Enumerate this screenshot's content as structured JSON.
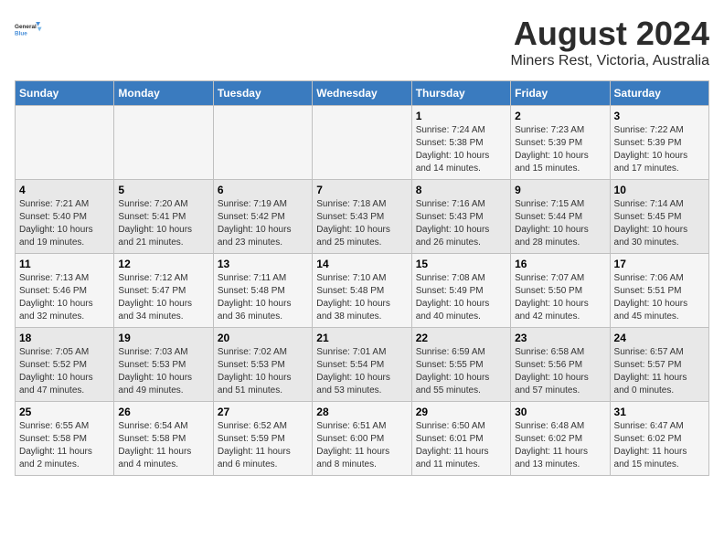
{
  "header": {
    "logo_line1": "General",
    "logo_line2": "Blue",
    "main_title": "August 2024",
    "subtitle": "Miners Rest, Victoria, Australia"
  },
  "days_of_week": [
    "Sunday",
    "Monday",
    "Tuesday",
    "Wednesday",
    "Thursday",
    "Friday",
    "Saturday"
  ],
  "weeks": [
    [
      {
        "day": "",
        "info": ""
      },
      {
        "day": "",
        "info": ""
      },
      {
        "day": "",
        "info": ""
      },
      {
        "day": "",
        "info": ""
      },
      {
        "day": "1",
        "info": "Sunrise: 7:24 AM\nSunset: 5:38 PM\nDaylight: 10 hours\nand 14 minutes."
      },
      {
        "day": "2",
        "info": "Sunrise: 7:23 AM\nSunset: 5:39 PM\nDaylight: 10 hours\nand 15 minutes."
      },
      {
        "day": "3",
        "info": "Sunrise: 7:22 AM\nSunset: 5:39 PM\nDaylight: 10 hours\nand 17 minutes."
      }
    ],
    [
      {
        "day": "4",
        "info": "Sunrise: 7:21 AM\nSunset: 5:40 PM\nDaylight: 10 hours\nand 19 minutes."
      },
      {
        "day": "5",
        "info": "Sunrise: 7:20 AM\nSunset: 5:41 PM\nDaylight: 10 hours\nand 21 minutes."
      },
      {
        "day": "6",
        "info": "Sunrise: 7:19 AM\nSunset: 5:42 PM\nDaylight: 10 hours\nand 23 minutes."
      },
      {
        "day": "7",
        "info": "Sunrise: 7:18 AM\nSunset: 5:43 PM\nDaylight: 10 hours\nand 25 minutes."
      },
      {
        "day": "8",
        "info": "Sunrise: 7:16 AM\nSunset: 5:43 PM\nDaylight: 10 hours\nand 26 minutes."
      },
      {
        "day": "9",
        "info": "Sunrise: 7:15 AM\nSunset: 5:44 PM\nDaylight: 10 hours\nand 28 minutes."
      },
      {
        "day": "10",
        "info": "Sunrise: 7:14 AM\nSunset: 5:45 PM\nDaylight: 10 hours\nand 30 minutes."
      }
    ],
    [
      {
        "day": "11",
        "info": "Sunrise: 7:13 AM\nSunset: 5:46 PM\nDaylight: 10 hours\nand 32 minutes."
      },
      {
        "day": "12",
        "info": "Sunrise: 7:12 AM\nSunset: 5:47 PM\nDaylight: 10 hours\nand 34 minutes."
      },
      {
        "day": "13",
        "info": "Sunrise: 7:11 AM\nSunset: 5:48 PM\nDaylight: 10 hours\nand 36 minutes."
      },
      {
        "day": "14",
        "info": "Sunrise: 7:10 AM\nSunset: 5:48 PM\nDaylight: 10 hours\nand 38 minutes."
      },
      {
        "day": "15",
        "info": "Sunrise: 7:08 AM\nSunset: 5:49 PM\nDaylight: 10 hours\nand 40 minutes."
      },
      {
        "day": "16",
        "info": "Sunrise: 7:07 AM\nSunset: 5:50 PM\nDaylight: 10 hours\nand 42 minutes."
      },
      {
        "day": "17",
        "info": "Sunrise: 7:06 AM\nSunset: 5:51 PM\nDaylight: 10 hours\nand 45 minutes."
      }
    ],
    [
      {
        "day": "18",
        "info": "Sunrise: 7:05 AM\nSunset: 5:52 PM\nDaylight: 10 hours\nand 47 minutes."
      },
      {
        "day": "19",
        "info": "Sunrise: 7:03 AM\nSunset: 5:53 PM\nDaylight: 10 hours\nand 49 minutes."
      },
      {
        "day": "20",
        "info": "Sunrise: 7:02 AM\nSunset: 5:53 PM\nDaylight: 10 hours\nand 51 minutes."
      },
      {
        "day": "21",
        "info": "Sunrise: 7:01 AM\nSunset: 5:54 PM\nDaylight: 10 hours\nand 53 minutes."
      },
      {
        "day": "22",
        "info": "Sunrise: 6:59 AM\nSunset: 5:55 PM\nDaylight: 10 hours\nand 55 minutes."
      },
      {
        "day": "23",
        "info": "Sunrise: 6:58 AM\nSunset: 5:56 PM\nDaylight: 10 hours\nand 57 minutes."
      },
      {
        "day": "24",
        "info": "Sunrise: 6:57 AM\nSunset: 5:57 PM\nDaylight: 11 hours\nand 0 minutes."
      }
    ],
    [
      {
        "day": "25",
        "info": "Sunrise: 6:55 AM\nSunset: 5:58 PM\nDaylight: 11 hours\nand 2 minutes."
      },
      {
        "day": "26",
        "info": "Sunrise: 6:54 AM\nSunset: 5:58 PM\nDaylight: 11 hours\nand 4 minutes."
      },
      {
        "day": "27",
        "info": "Sunrise: 6:52 AM\nSunset: 5:59 PM\nDaylight: 11 hours\nand 6 minutes."
      },
      {
        "day": "28",
        "info": "Sunrise: 6:51 AM\nSunset: 6:00 PM\nDaylight: 11 hours\nand 8 minutes."
      },
      {
        "day": "29",
        "info": "Sunrise: 6:50 AM\nSunset: 6:01 PM\nDaylight: 11 hours\nand 11 minutes."
      },
      {
        "day": "30",
        "info": "Sunrise: 6:48 AM\nSunset: 6:02 PM\nDaylight: 11 hours\nand 13 minutes."
      },
      {
        "day": "31",
        "info": "Sunrise: 6:47 AM\nSunset: 6:02 PM\nDaylight: 11 hours\nand 15 minutes."
      }
    ]
  ]
}
